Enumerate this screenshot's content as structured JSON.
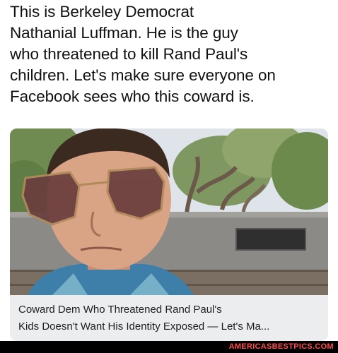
{
  "post": {
    "lines": [
      "This is Berkeley Democrat",
      "Nathanial Luffman. He is the guy",
      "who threatened to kill Rand Paul's",
      "children. Let's make sure everyone on",
      "Facebook sees who this coward is."
    ]
  },
  "link_preview": {
    "caption_lines": [
      "Coward Dem Who Threatened Rand Paul's",
      "Kids Doesn't Want His Identity Exposed — Let's Ma..."
    ]
  },
  "watermark": "AMERICASBESTPICS.COM",
  "colors": {
    "text": "#111111",
    "caption_bg": "#ecedef",
    "watermark": "#ff4d4d",
    "watermark_bg": "#000000"
  }
}
